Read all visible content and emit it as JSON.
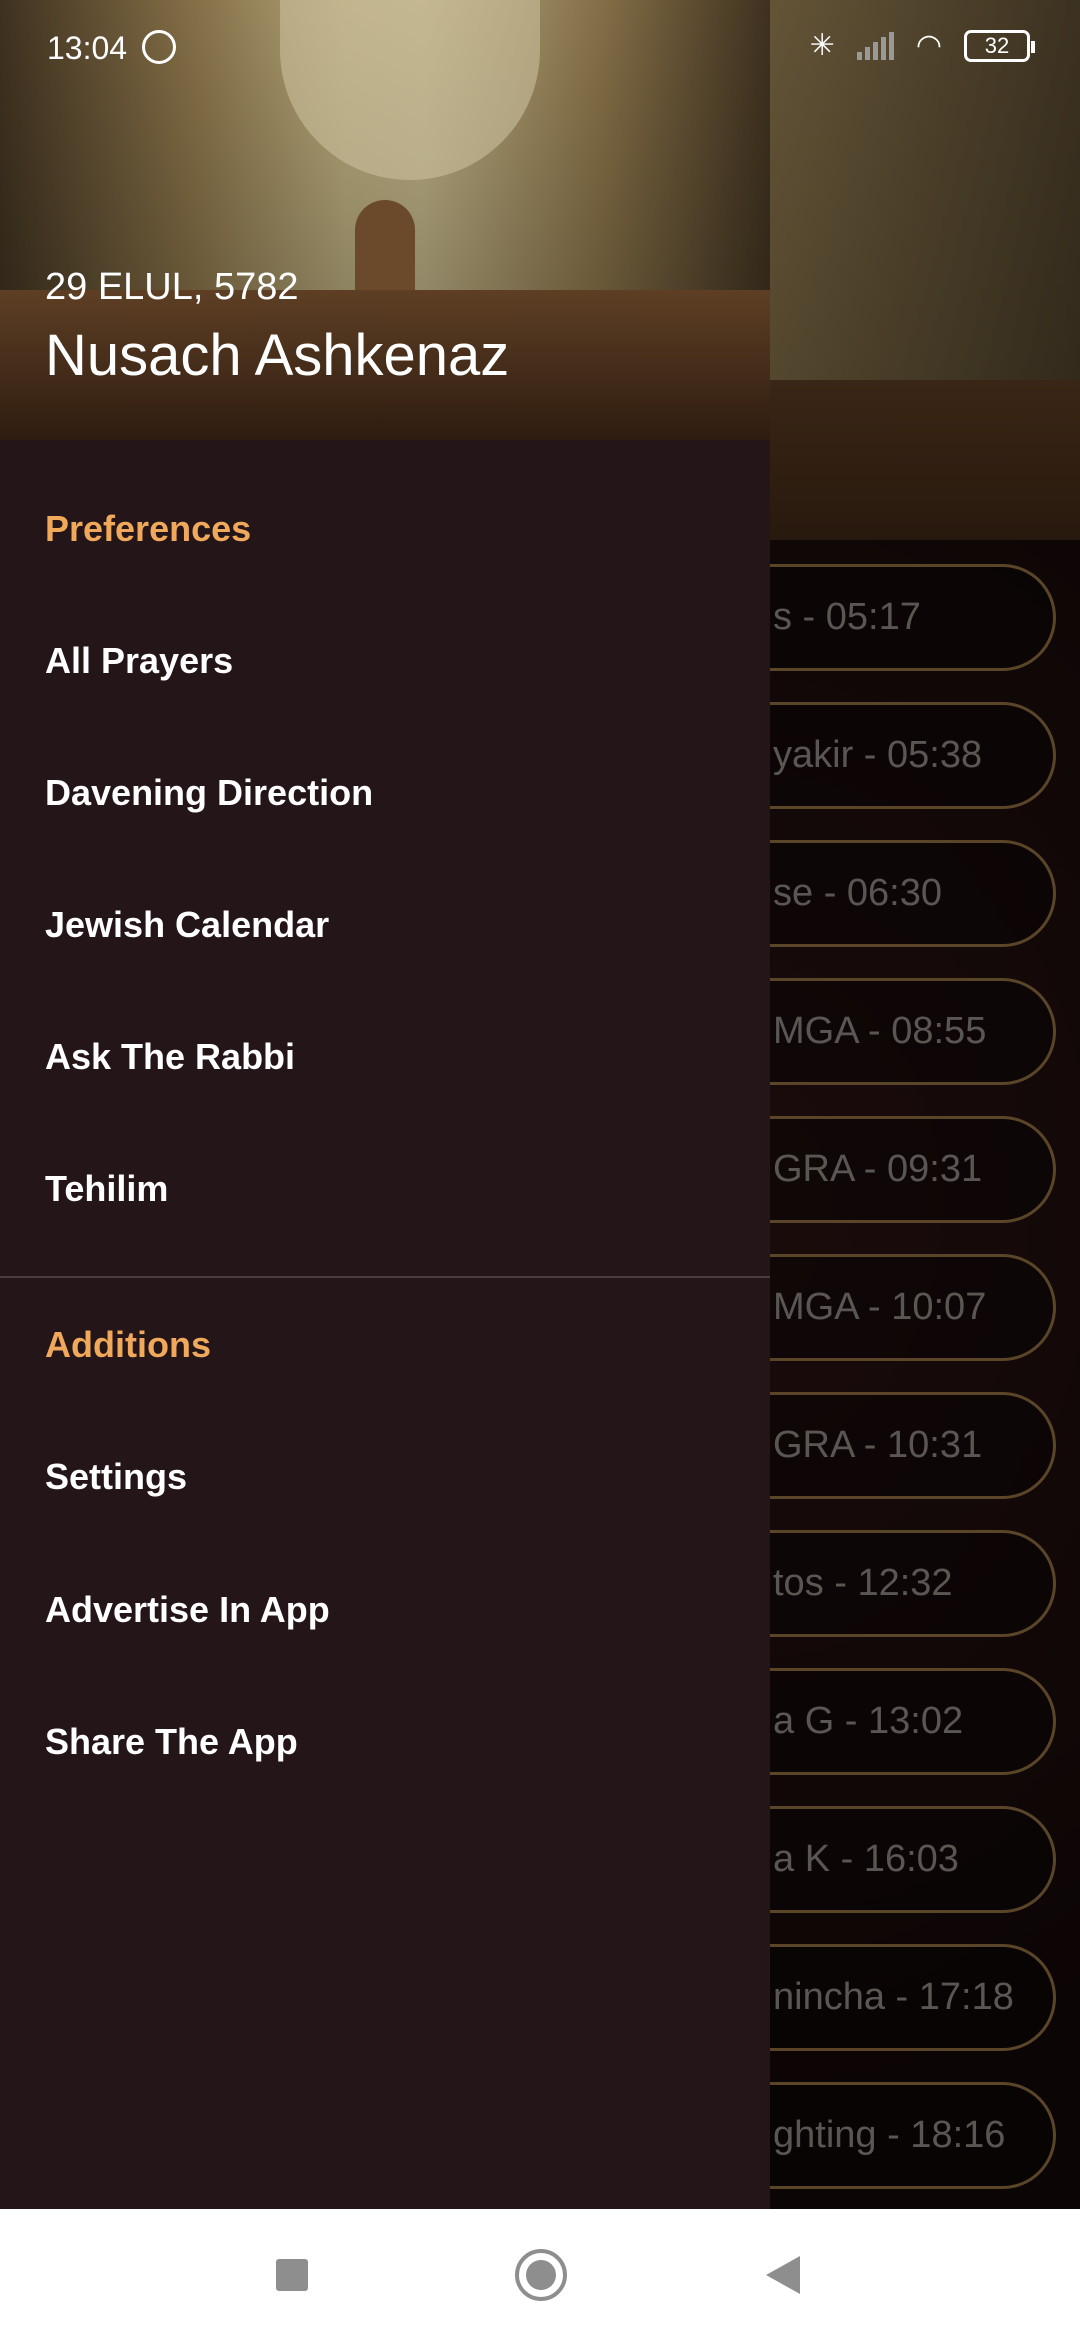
{
  "status_bar": {
    "time": "13:04",
    "battery": "32",
    "icons": [
      "alarm-icon",
      "bluetooth-icon",
      "signal-icon",
      "wifi-icon",
      "battery-icon"
    ]
  },
  "drawer": {
    "header": {
      "date": "29 ELUL, 5782",
      "title": "Nusach Ashkenaz"
    },
    "sections": [
      {
        "title": "Preferences",
        "items": [
          "All Prayers",
          "Davening Direction",
          "Jewish Calendar",
          "Ask The Rabbi",
          "Tehilim"
        ]
      },
      {
        "title": "Additions",
        "items": [
          "Settings",
          "Advertise In App",
          "Share The App"
        ]
      }
    ]
  },
  "background_times": [
    "s - 05:17",
    "yakir - 05:38",
    "se - 06:30",
    "MGA - 08:55",
    "GRA - 09:31",
    "MGA - 10:07",
    "GRA - 10:31",
    "tos - 12:32",
    "a G - 13:02",
    "a K - 16:03",
    "nincha - 17:18",
    "ghting - 18:16"
  ],
  "colors": {
    "accent": "#f0a85a",
    "drawer_bg": "#241519",
    "pill_border": "#8a6a3e"
  }
}
